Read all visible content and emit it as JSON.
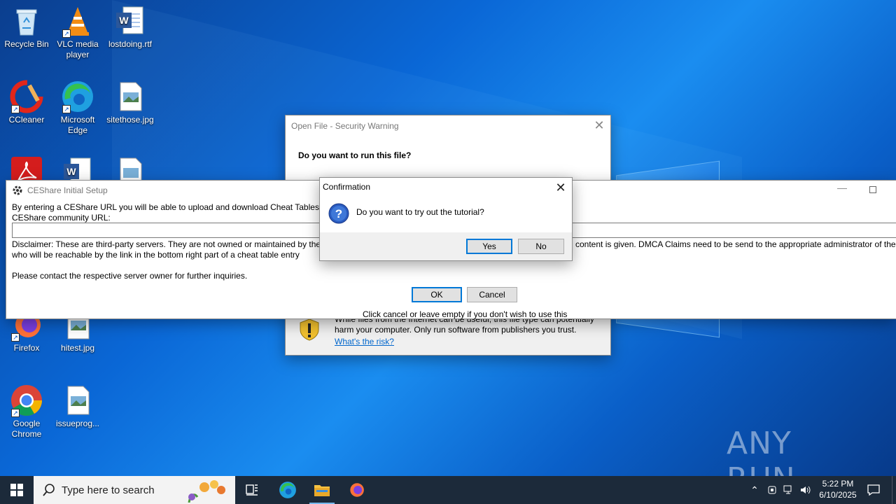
{
  "desktop_icons": [
    {
      "id": "recycle",
      "label": "Recycle Bin",
      "icon": "recycle-bin-icon"
    },
    {
      "id": "vlc",
      "label": "VLC media player",
      "icon": "vlc-icon"
    },
    {
      "id": "lostdoing",
      "label": "lostdoing.rtf",
      "icon": "word-doc-icon"
    },
    {
      "id": "ccleaner",
      "label": "CCleaner",
      "icon": "ccleaner-icon"
    },
    {
      "id": "edge",
      "label": "Microsoft Edge",
      "icon": "edge-icon"
    },
    {
      "id": "sitethose",
      "label": "sitethose.jpg",
      "icon": "image-file-icon"
    },
    {
      "id": "firefox",
      "label": "Firefox",
      "icon": "firefox-icon"
    },
    {
      "id": "hitest",
      "label": "hitest.jpg",
      "icon": "image-file-icon"
    },
    {
      "id": "chrome",
      "label": "Google Chrome",
      "icon": "chrome-icon"
    },
    {
      "id": "issueprog",
      "label": "issueprog...",
      "icon": "image-file-icon"
    }
  ],
  "security_warning": {
    "title": "Open File - Security Warning",
    "question": "Do you want to run this file?",
    "risk_text": "While files from the Internet can be useful, this file type can potentially harm your computer. Only run software from publishers you trust.",
    "risk_link": "What's the risk?"
  },
  "ceshare": {
    "title": "CEShare Initial Setup",
    "intro": "By entering a CEShare URL you will be able to upload and download Cheat Tables fro",
    "url_label": "CEShare community URL:",
    "url_value": "",
    "disclaimer_left": "Disclaimer: These are third-party servers. They are not owned or maintained by the C",
    "disclaimer_right": "content is given.  DMCA Claims need to be send to the appropriate administrator of the",
    "disclaimer_line2": "who will be reachable by the link in the bottom right part of a cheat table entry",
    "contact": "Please contact the respective server owner for further inquiries.",
    "ok_label": "OK",
    "cancel_label": "Cancel",
    "hint": "Click cancel or leave empty if you don't wish to use this"
  },
  "confirmation": {
    "title": "Confirmation",
    "message": "Do you want to try out the tutorial?",
    "yes_label": "Yes",
    "no_label": "No"
  },
  "taskbar": {
    "search_placeholder": "Type here to search",
    "time": "5:22 PM",
    "date": "6/10/2025"
  },
  "watermark": "ANY RUN",
  "colors": {
    "accent": "#0078d7",
    "taskbar": "#1c2a3a",
    "link": "#0066cc"
  }
}
